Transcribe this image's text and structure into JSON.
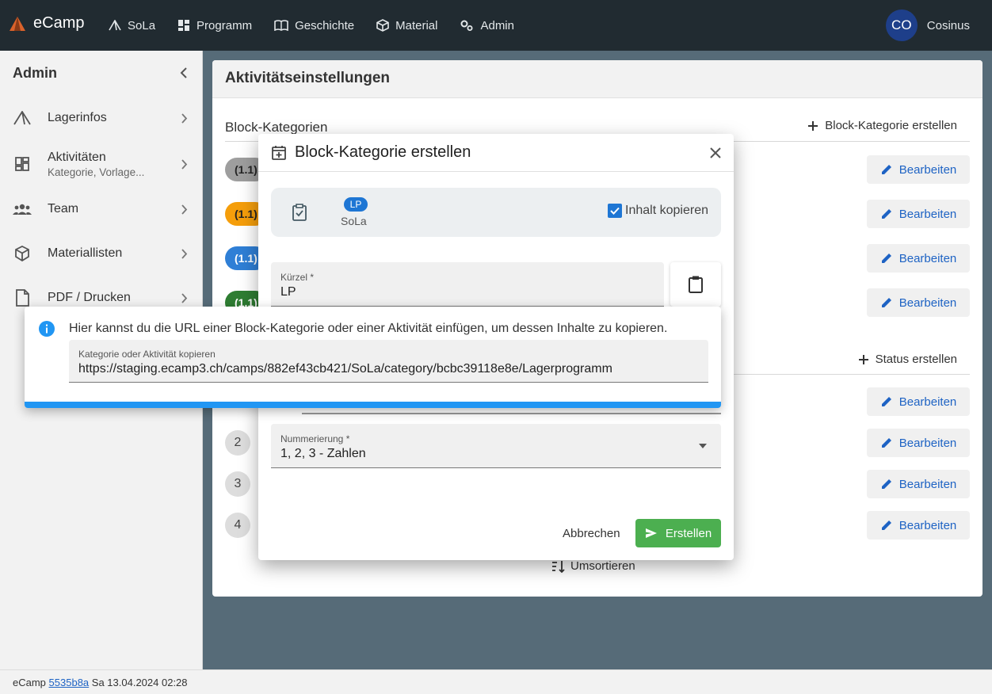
{
  "topbar": {
    "brand": "eCamp",
    "nav": [
      {
        "label": "SoLa",
        "icon": "tent-icon"
      },
      {
        "label": "Programm",
        "icon": "dashboard-icon"
      },
      {
        "label": "Geschichte",
        "icon": "book-icon"
      },
      {
        "label": "Material",
        "icon": "package-icon"
      },
      {
        "label": "Admin",
        "icon": "cogs-icon"
      }
    ],
    "avatar": "CO",
    "user_name": "Cosinus"
  },
  "sidebar": {
    "title": "Admin",
    "items": [
      {
        "label": "Lagerinfos",
        "sub": ""
      },
      {
        "label": "Aktivitäten",
        "sub": "Kategorie, Vorlage..."
      },
      {
        "label": "Team",
        "sub": ""
      },
      {
        "label": "Materiallisten",
        "sub": ""
      },
      {
        "label": "PDF / Drucken",
        "sub": ""
      }
    ]
  },
  "main": {
    "title": "Aktivitätseinstellungen",
    "block_section": {
      "title": "Block-Kategorien",
      "create_label": "Block-Kategorie erstellen"
    },
    "chips": [
      {
        "label": "(1.1)",
        "bg": "#9e9e9e",
        "color": "#222222"
      },
      {
        "label": "(1.1)",
        "bg": "#f59e0b",
        "color": "#222222"
      },
      {
        "label": "(1.1)",
        "bg": "#2f7fd6",
        "color": "#ffffff"
      },
      {
        "label": "(1.1)",
        "bg": "#2e7d32",
        "color": "#ffffff"
      }
    ],
    "status_section": {
      "create_label": "Status erstellen"
    },
    "status_numbers": [
      "2",
      "3",
      "4"
    ],
    "edit_label": "Bearbeiten",
    "resort_label": "Umsortieren"
  },
  "dialog": {
    "title": "Block-Kategorie erstellen",
    "copy_badge": "LP",
    "copy_source": "SoLa",
    "copy_checkbox_label": "Inhalt kopieren",
    "short_label": "Kürzel",
    "short_value": "LP",
    "numbering_label": "Nummerierung",
    "numbering_value": "1, 2, 3 - Zahlen",
    "cancel_label": "Abbrechen",
    "create_label": "Erstellen"
  },
  "info_popup": {
    "text": "Hier kannst du die URL einer Block-Kategorie oder einer Aktivität einfügen, um dessen Inhalte zu kopieren.",
    "field_label": "Kategorie oder Aktivität kopieren",
    "field_value": "https://staging.ecamp3.ch/camps/882ef43cb421/SoLa/category/bcbc39118e8e/Lagerprogramm"
  },
  "footer": {
    "app": "eCamp",
    "version": "5535b8a",
    "date": "Sa 13.04.2024 02:28"
  },
  "colors": {
    "accent": "#1e63c4",
    "success": "#4caf50",
    "info": "#2196f3"
  }
}
